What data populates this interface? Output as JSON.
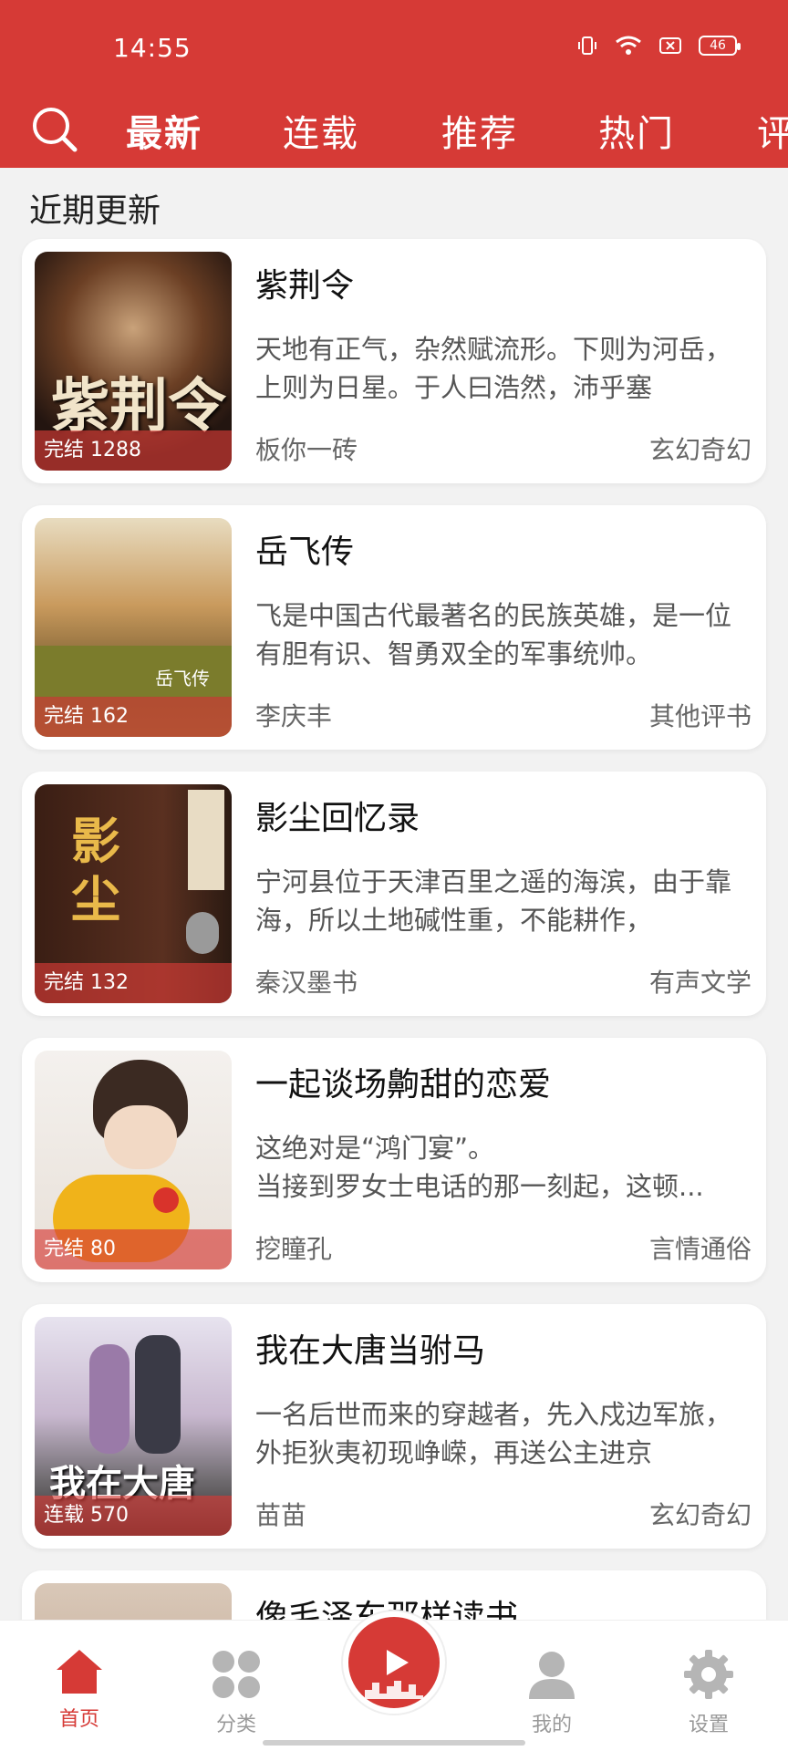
{
  "status_bar": {
    "time": "14:55",
    "battery": "46"
  },
  "tabs": [
    "最新",
    "连载",
    "推荐",
    "热门",
    "评"
  ],
  "section_title": "近期更新",
  "books": [
    {
      "title": "紫荆令",
      "desc": "天地有正气，杂然赋流形。下则为河岳，上则为日星。于人曰浩然，沛乎塞",
      "author": "板你一砖",
      "genre": "玄幻奇幻",
      "badge": "完结 1288",
      "cover_text": "紫荆令"
    },
    {
      "title": "岳飞传",
      "desc": "飞是中国古代最著名的民族英雄，是一位有胆有识、智勇双全的军事统帅。",
      "author": "李庆丰",
      "genre": "其他评书",
      "badge": "完结 162",
      "cover_text": "岳飞传"
    },
    {
      "title": "影尘回忆录",
      "desc": "宁河县位于天津百里之遥的海滨，由于靠海，所以土地碱性重，不能耕作，",
      "author": "秦汉墨书",
      "genre": "有声文学",
      "badge": "完结 132",
      "cover_text": "影尘"
    },
    {
      "title": "一起谈场齁甜的恋爱",
      "desc": "这绝对是“鸿门宴”。\n当接到罗女士电话的那一刻起，这顿...",
      "author": "挖瞳孔",
      "genre": "言情通俗",
      "badge": "完结 80",
      "cover_text": ""
    },
    {
      "title": "我在大唐当驸马",
      "desc": "一名后世而来的穿越者，先入戍边军旅，外拒狄夷初现峥嵘，再送公主进京",
      "author": "苗苗",
      "genre": "玄幻奇幻",
      "badge": "连载 570",
      "cover_text": "我在大唐"
    },
    {
      "title": "像毛泽东那样读书",
      "desc": "",
      "author": "",
      "genre": "",
      "badge": "",
      "cover_text": ""
    }
  ],
  "bottom_nav": [
    {
      "label": "首页",
      "icon": "home-icon"
    },
    {
      "label": "分类",
      "icon": "grid-icon"
    },
    {
      "label": "",
      "icon": "play-icon"
    },
    {
      "label": "我的",
      "icon": "user-icon"
    },
    {
      "label": "设置",
      "icon": "gear-icon"
    }
  ],
  "colors": {
    "accent": "#d63a36",
    "background": "#f2f2f2"
  }
}
